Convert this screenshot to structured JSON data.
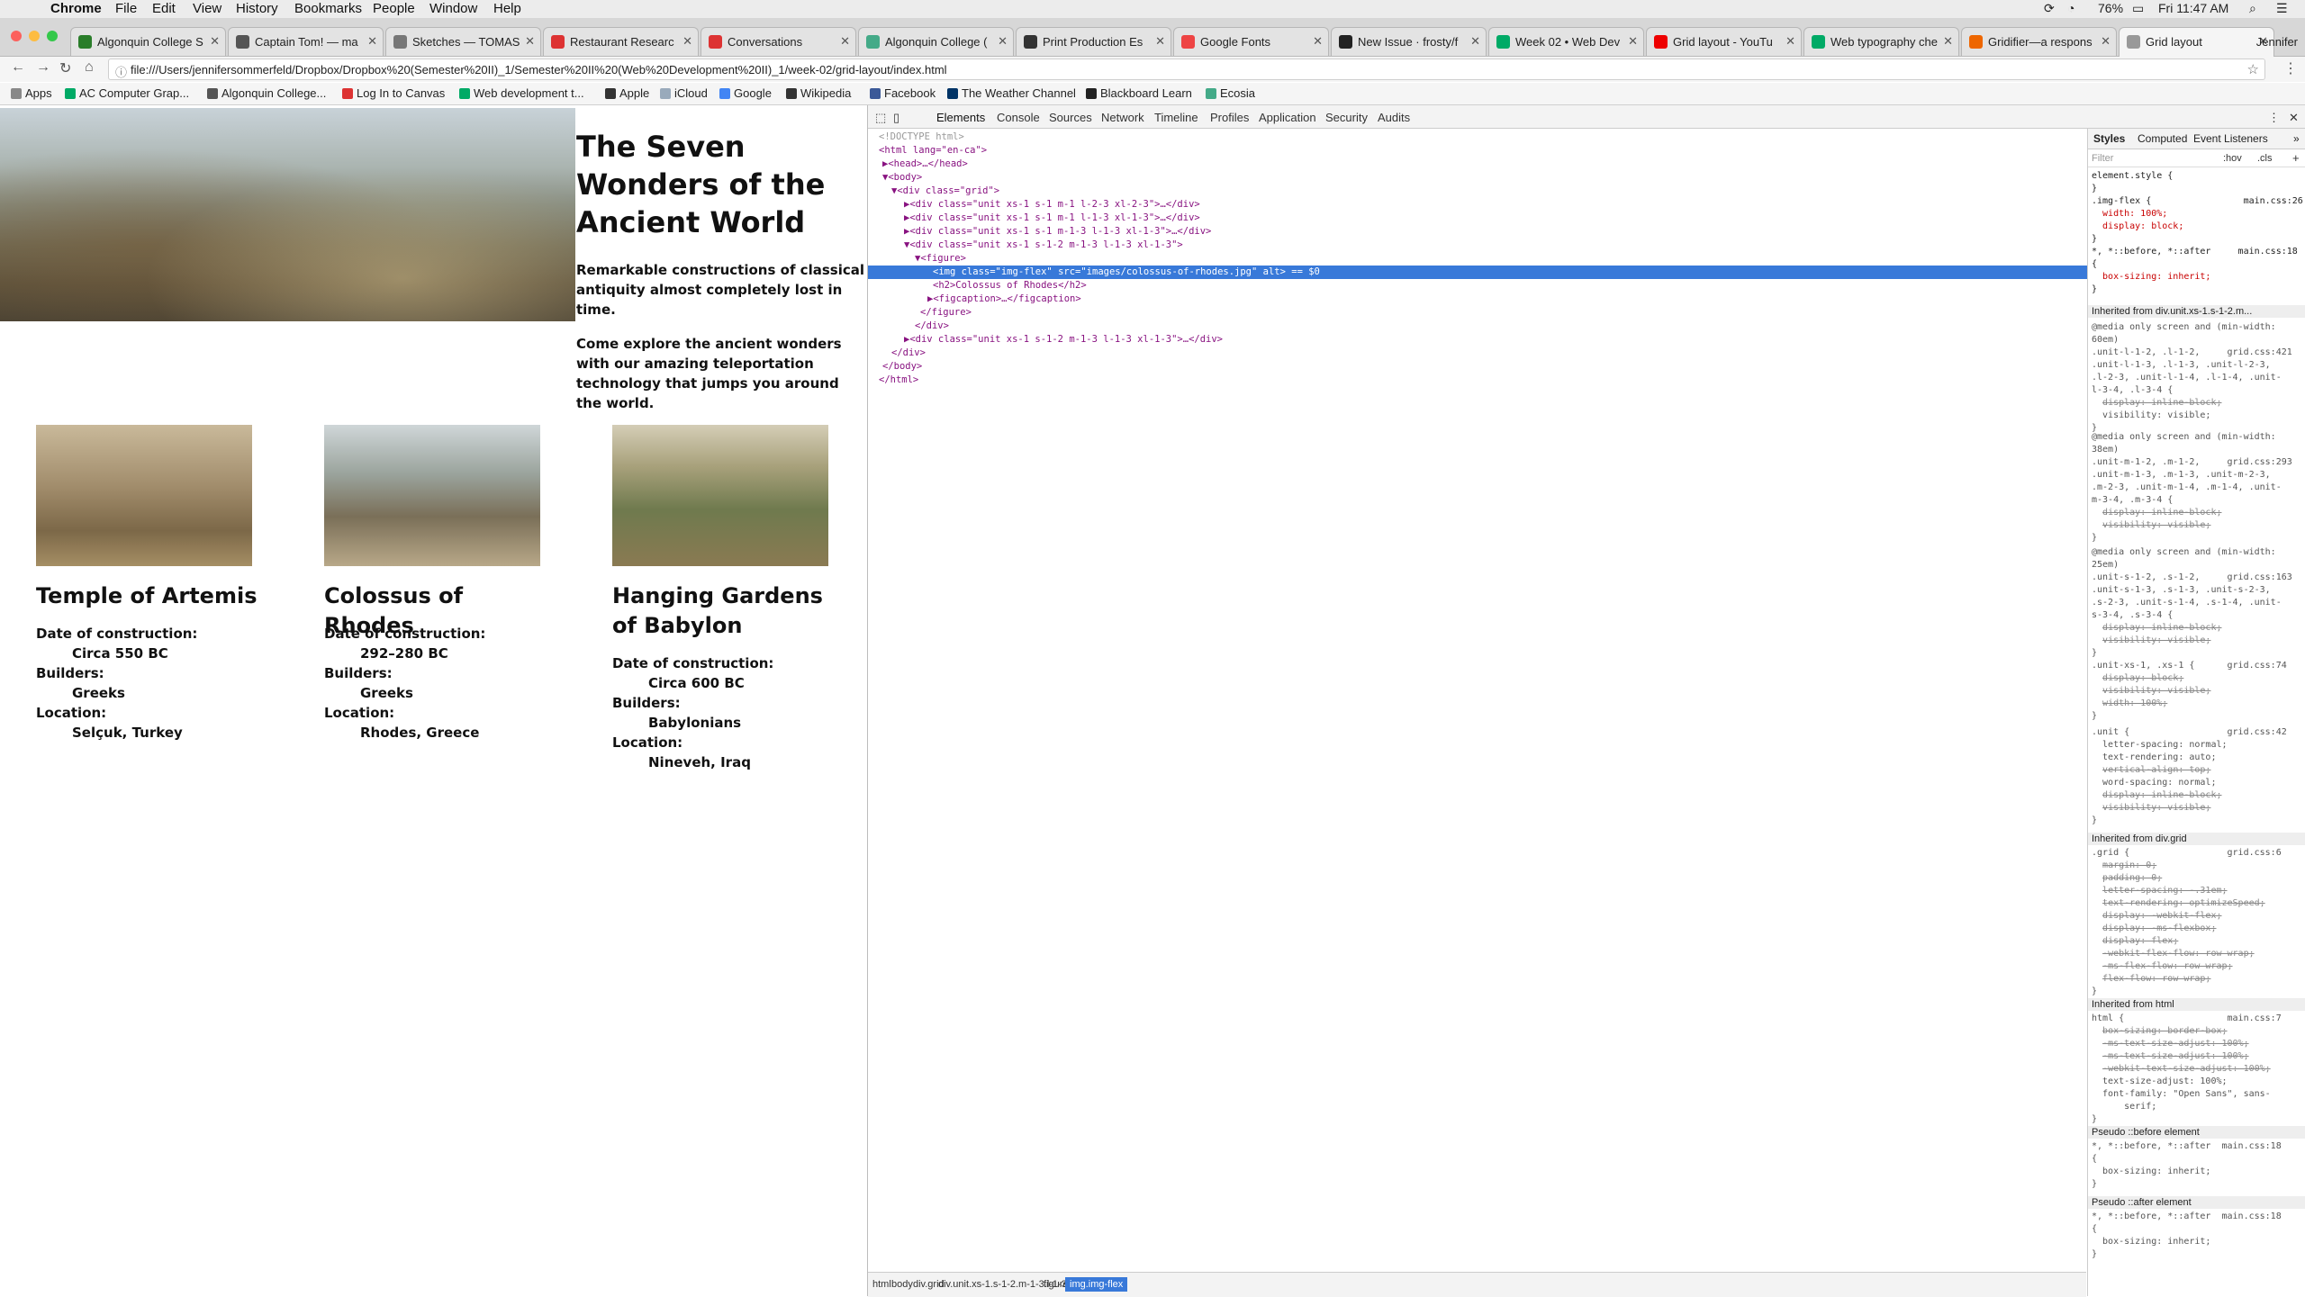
{
  "menubar": {
    "items": [
      "Chrome",
      "File",
      "Edit",
      "View",
      "History",
      "Bookmarks",
      "People",
      "Window",
      "Help"
    ],
    "battery": "76%",
    "time": "Fri 11:47 AM"
  },
  "tabs": [
    {
      "label": "Algonquin College S",
      "color": "#2a7d2a"
    },
    {
      "label": "Captain Tom! — ma",
      "color": "#555"
    },
    {
      "label": "Sketches — TOMAS",
      "color": "#777"
    },
    {
      "label": "Restaurant Researc",
      "color": "#d33"
    },
    {
      "label": "Conversations",
      "color": "#d33"
    },
    {
      "label": "Algonquin College (",
      "color": "#4a8"
    },
    {
      "label": "Print Production Es",
      "color": "#333"
    },
    {
      "label": "Google Fonts",
      "color": "#e44"
    },
    {
      "label": "New Issue · frosty/f",
      "color": "#222"
    },
    {
      "label": "Week 02 • Web Dev",
      "color": "#0a6"
    },
    {
      "label": "Grid layout - YouTu",
      "color": "#e00"
    },
    {
      "label": "Web typography che",
      "color": "#0a6"
    },
    {
      "label": "Gridifier—a respons",
      "color": "#e60"
    },
    {
      "label": "Grid layout",
      "color": "#999",
      "active": true
    }
  ],
  "profile": "Jennifer",
  "url": "file:///Users/jennifersommerfeld/Dropbox/Dropbox%20(Semester%20II)_1/Semester%20II%20(Web%20Development%20II)_1/week-02/grid-layout/index.html",
  "bookmarks": [
    {
      "label": "Apps",
      "color": "#888"
    },
    {
      "label": "AC Computer Grap...",
      "color": "#0a6"
    },
    {
      "label": "Algonquin College...",
      "color": "#555"
    },
    {
      "label": "Log In to Canvas",
      "color": "#d33"
    },
    {
      "label": "Web development t...",
      "color": "#0a6"
    },
    {
      "label": "Apple",
      "color": "#333"
    },
    {
      "label": "iCloud",
      "color": "#9ab"
    },
    {
      "label": "Google",
      "color": "#4285f4"
    },
    {
      "label": "Wikipedia",
      "color": "#333"
    },
    {
      "label": "Facebook",
      "color": "#3b5998"
    },
    {
      "label": "The Weather Channel",
      "color": "#036"
    },
    {
      "label": "Blackboard Learn",
      "color": "#222"
    },
    {
      "label": "Ecosia",
      "color": "#4a8"
    }
  ],
  "page": {
    "title": "The Seven Wonders of the Ancient World",
    "intro1": "Remarkable constructions of classical antiquity almost completely lost in time.",
    "intro2": "Come explore the ancient wonders with our amazing teleportation technology that jumps you around the world.",
    "cards": [
      {
        "name": "Temple of Artemis",
        "date_label": "Date of construction:",
        "date": "Circa 550 BC",
        "builders_label": "Builders:",
        "builders": "Greeks",
        "location_label": "Location:",
        "location": "Selçuk, Turkey"
      },
      {
        "name": "Colossus of Rhodes",
        "date_label": "Date of construction:",
        "date": "292–280 BC",
        "builders_label": "Builders:",
        "builders": "Greeks",
        "location_label": "Location:",
        "location": "Rhodes, Greece"
      },
      {
        "name": "Hanging Gardens of Babylon",
        "date_label": "Date of construction:",
        "date": "Circa 600 BC",
        "builders_label": "Builders:",
        "builders": "Babylonians",
        "location_label": "Location:",
        "location": "Nineveh, Iraq"
      }
    ]
  },
  "devtools": {
    "tabs": [
      "Elements",
      "Console",
      "Sources",
      "Network",
      "Timeline",
      "Profiles",
      "Application",
      "Security",
      "Audits"
    ],
    "dom_lines": [
      {
        "text": "<!DOCTYPE html>",
        "kind": "cmt"
      },
      {
        "text": "<html lang=\"en-ca\">"
      },
      {
        "text": "▶<head>…</head>"
      },
      {
        "text": "▼<body>"
      },
      {
        "text": "▼<div class=\"grid\">"
      },
      {
        "text": "▶<div class=\"unit xs-1 s-1 m-1 l-2-3 xl-2-3\">…</div>"
      },
      {
        "text": "▶<div class=\"unit xs-1 s-1 m-1 l-1-3 xl-1-3\">…</div>"
      },
      {
        "text": "▶<div class=\"unit xs-1 s-1 m-1-3 l-1-3 xl-1-3\">…</div>"
      },
      {
        "text": "▼<div class=\"unit xs-1 s-1-2 m-1-3 l-1-3 xl-1-3\">"
      },
      {
        "text": "▼<figure>"
      },
      {
        "text": "<img class=\"img-flex\" src=\"images/colossus-of-rhodes.jpg\" alt> == $0",
        "selected": true
      },
      {
        "text": "<h2>Colossus of Rhodes</h2>"
      },
      {
        "text": "▶<figcaption>…</figcaption>"
      },
      {
        "text": "</figure>"
      },
      {
        "text": "</div>"
      },
      {
        "text": "▶<div class=\"unit xs-1 s-1-2 m-1-3 l-1-3 xl-1-3\">…</div>"
      },
      {
        "text": "</div>"
      },
      {
        "text": "</body>"
      },
      {
        "text": "</html>"
      }
    ],
    "styles_tabs": [
      "Styles",
      "Computed",
      "Event Listeners"
    ],
    "filter": "Filter",
    "filter_hov": ":hov",
    "filter_cls": ".cls",
    "style_lines": [
      "element.style {",
      "}",
      ".img-flex {                 main.css:26",
      "  width: 100%;",
      "  display: block;",
      "}",
      "*, *::before, *::after     main.css:18",
      "{",
      "  box-sizing: inherit;",
      "}"
    ],
    "inherited_1": "Inherited from div.unit.xs-1.s-1-2.m...",
    "inherited_2": "Inherited from div.grid",
    "inherited_3": "Inherited from html",
    "pseudo_before": "Pseudo ::before element",
    "pseudo_after": "Pseudo ::after element",
    "breadcrumbs": [
      "html",
      "body",
      "div.grid",
      "div.unit.xs-1.s-1-2.m-1-3.l-1-3.xl-1-3",
      "figure",
      "img.img-flex"
    ]
  }
}
